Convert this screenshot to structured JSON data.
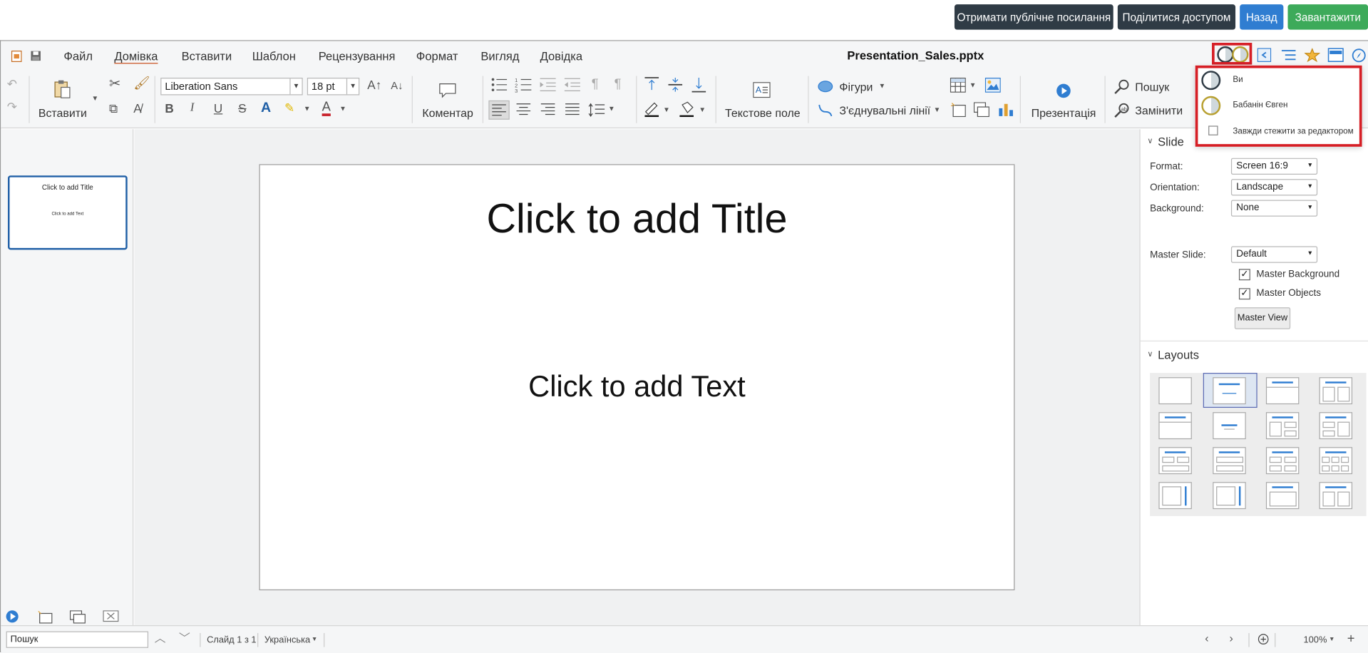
{
  "top_actions": {
    "public_link": "Отримати публічне посилання",
    "share": "Поділитися доступом",
    "back": "Назад",
    "download": "Завантажити"
  },
  "menu": {
    "items": [
      "Файл",
      "Домівка",
      "Вставити",
      "Шаблон",
      "Рецензування",
      "Формат",
      "Вигляд",
      "Довідка"
    ],
    "active": "Домівка",
    "document_title": "Presentation_Sales.pptx"
  },
  "ribbon": {
    "paste": "Вставити",
    "font_name": "Liberation Sans",
    "font_size": "18 pt",
    "comment": "Коментар",
    "text_box": "Текстове поле",
    "shapes": "Фігури",
    "connectors": "З'єднувальні лінії",
    "presentation": "Презентація",
    "find": "Пошук",
    "replace": "Замінити"
  },
  "slide_thumb": {
    "title": "Click to add Title",
    "text": "Click to add Text"
  },
  "slide": {
    "title": "Click to add Title",
    "text": "Click to add Text"
  },
  "sidebar": {
    "slide_section": "Slide",
    "format_label": "Format:",
    "format_value": "Screen 16:9",
    "orientation_label": "Orientation:",
    "orientation_value": "Landscape",
    "background_label": "Background:",
    "background_value": "None",
    "master_slide_label": "Master Slide:",
    "master_slide_value": "Default",
    "master_background": "Master Background",
    "master_objects": "Master Objects",
    "master_view": "Master View",
    "layouts_section": "Layouts"
  },
  "users_popup": {
    "you": "Ви",
    "other_user": "Бабанін Євген",
    "follow_editor": "Завжди стежити за редактором"
  },
  "statusbar": {
    "search_placeholder": "Пошук",
    "slide_counter": "Слайд 1 з 1",
    "language": "Українська",
    "zoom": "100%"
  },
  "colors": {
    "dark_button": "#2f3b45",
    "blue_button": "#2f7dd1",
    "green_button": "#3daa5a",
    "highlight": "#d61f26",
    "thumb_border": "#1f5fa6"
  }
}
